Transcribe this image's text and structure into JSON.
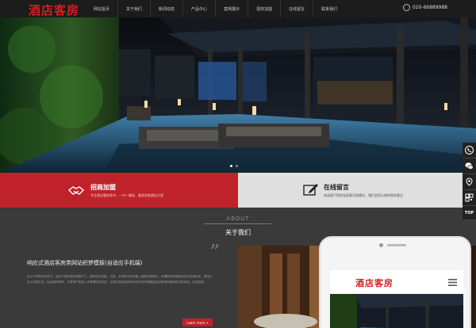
{
  "header": {
    "logo": "酒店客房",
    "nav": [
      "网站首页",
      "关于我们",
      "新闻动态",
      "产品中心",
      "案例展示",
      "招商加盟",
      "在线留言",
      "联系我们"
    ],
    "phone": "020-66889988"
  },
  "hero": {
    "slides": 2,
    "active_slide": 0
  },
  "features": [
    {
      "title": "招商加盟",
      "subtitle": "专注酒店客房多年，一对一服务，量身定制酒店方案",
      "icon": "handshake-icon"
    },
    {
      "title": "在线留言",
      "subtitle": "欢迎留下您的宝贵意见和建议，我们会用心倾听您的意见",
      "icon": "edit-icon"
    }
  ],
  "about": {
    "label_en": "ABOUT",
    "label_cn": "关于我们",
    "heading": "响应式酒店客房类网站织梦模板(自适应手机端)",
    "text": "定义不同条件的样式，适应不同终端的屏幕尺寸，使网站在电脑、平板、手机等不同设备上都能完美展示。本模板采用最新响应式布局技术，整站栏目与功能齐全，后台操作简单，方便用户快速上手管理网站内容，让您的酒店客房网站在任何终端都能给访客带来最佳的浏览体验，欢迎选购。",
    "more": "Learn more +"
  },
  "mobile_preview": {
    "logo": "酒店客房"
  },
  "sidebar": [
    {
      "icon": "phone-icon"
    },
    {
      "icon": "wechat-icon"
    },
    {
      "icon": "map-pin-icon"
    },
    {
      "icon": "qrcode-icon"
    },
    {
      "label": "TOP"
    }
  ],
  "colors": {
    "accent": "#c0222a",
    "dark": "#1c1c1c",
    "panel": "#3a3a3a"
  }
}
